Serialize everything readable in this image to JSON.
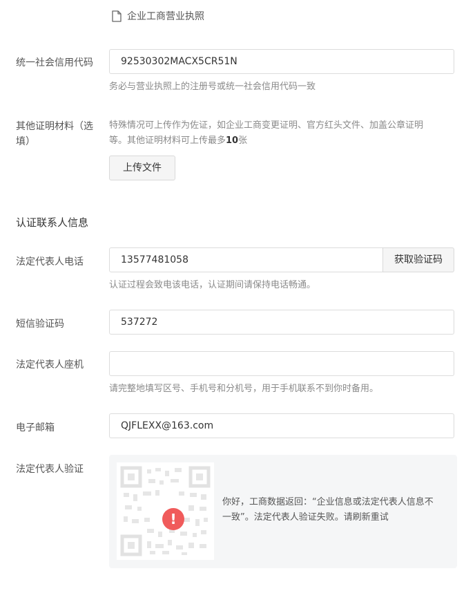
{
  "license_file": {
    "icon": "document-icon",
    "name": "企业工商营业执照"
  },
  "credit_code": {
    "label": "统一社会信用代码",
    "value": "92530302MACX5CR51N",
    "hint": "务必与营业执照上的注册号或统一社会信用代码一致"
  },
  "other_materials": {
    "label_line1": "其他证明材料（选",
    "label_line2": "填）",
    "desc_line1": "特殊情况可上传作为佐证，如企业工商变更证明、官方红头文件、加盖公章证明",
    "desc_line2_prefix": "等。其他证明材料可上传最多",
    "desc_max": "10",
    "desc_line2_suffix": "张",
    "upload_button": "上传文件"
  },
  "contact_section": {
    "title": "认证联系人信息"
  },
  "legal_phone": {
    "label": "法定代表人电话",
    "value": "13577481058",
    "get_code_button": "获取验证码",
    "hint": "认证过程会致电该电话，认证期间请保持电话畅通。"
  },
  "sms_code": {
    "label": "短信验证码",
    "value": "537272"
  },
  "landline": {
    "label": "法定代表人座机",
    "value": "",
    "hint": "请完整地填写区号、手机号和分机号，用于手机联系不到你时备用。"
  },
  "email": {
    "label": "电子邮箱",
    "value": "QJFLEXX@163.com"
  },
  "legal_verify": {
    "label": "法定代表人验证",
    "alert_mark": "!",
    "message_line1": "你好，工商数据返回：“企业信息或法定代表人信息不",
    "message_line2": "一致”。法定代表人验证失败。请刷新重试",
    "colors": {
      "alert": "#f05b5b",
      "panel_bg": "#f5f6f7"
    }
  }
}
